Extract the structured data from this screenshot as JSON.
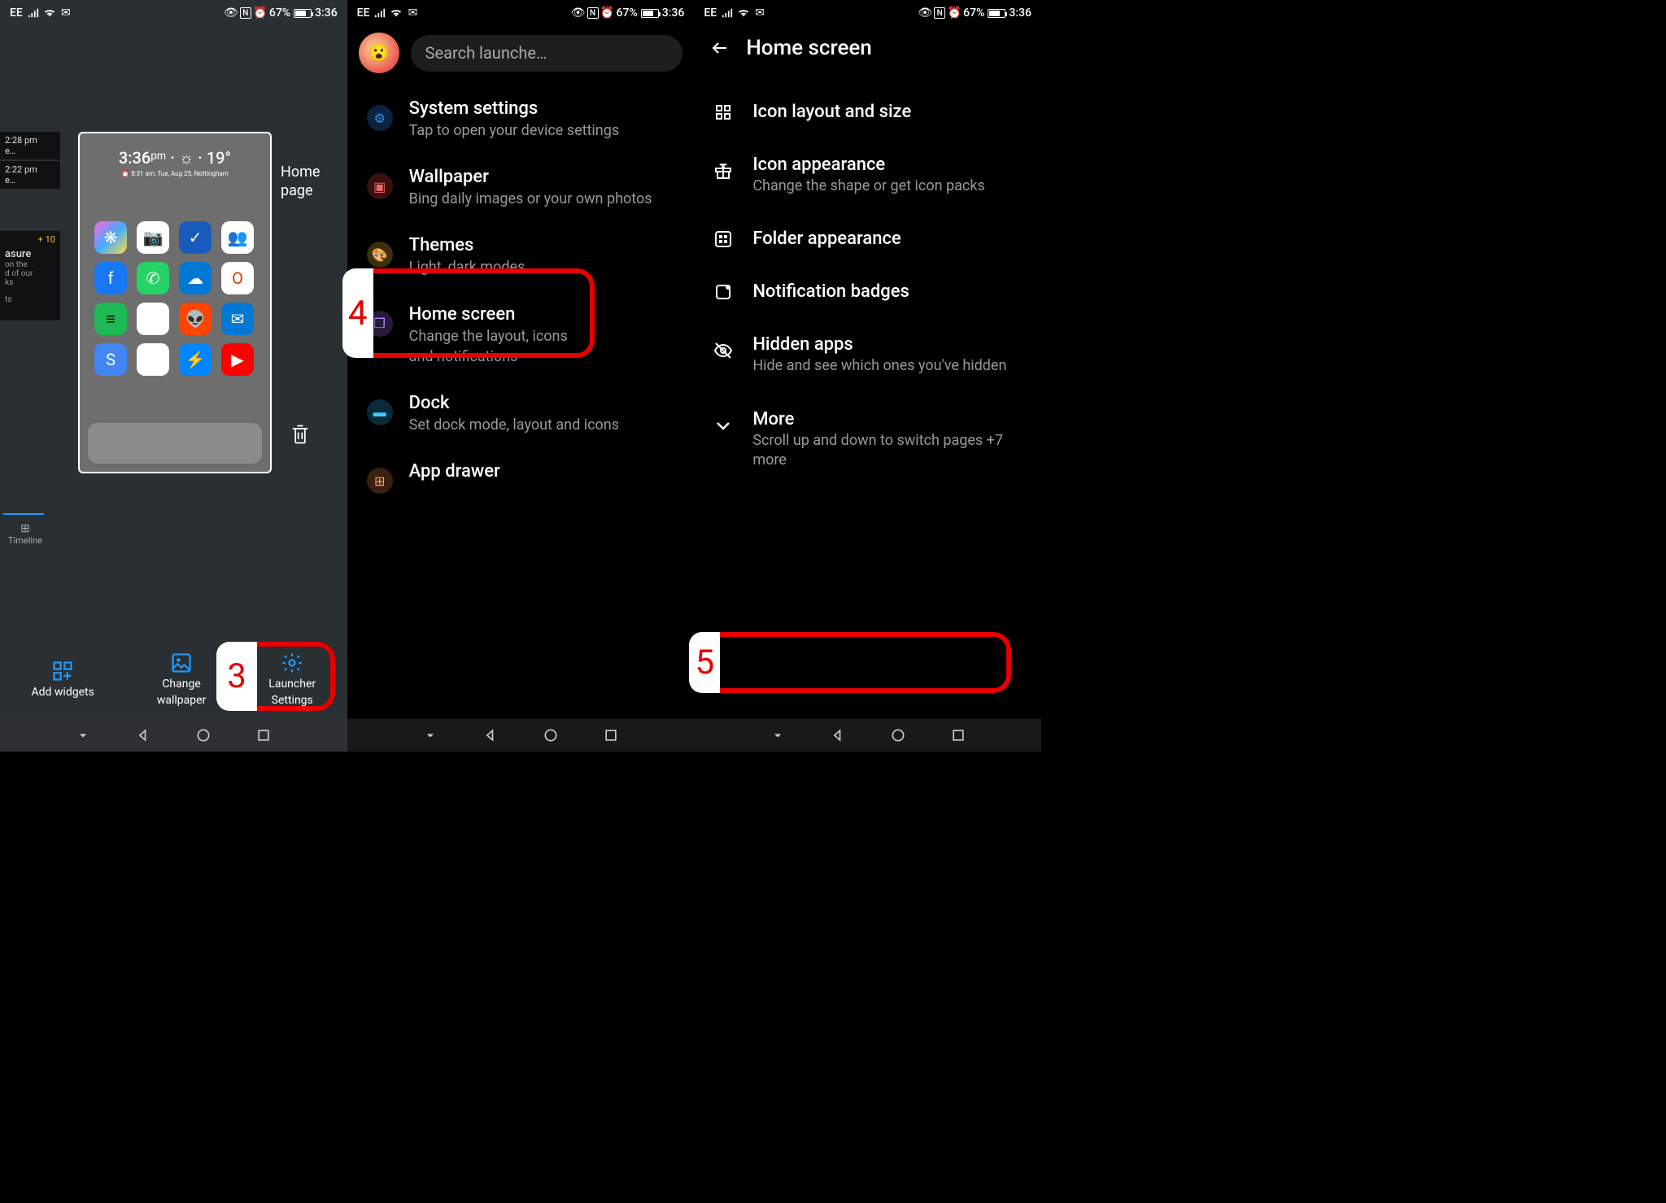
{
  "status": {
    "carrier": "EE",
    "battery": "67%",
    "time": "3:36",
    "nfc": "N"
  },
  "screen1": {
    "preview": {
      "time": "3:36ᵖᵐ · ☼ · 19°",
      "date": "⏰ 8:31 am, Tue, Aug 25, Nottingham"
    },
    "home_page_label_l1": "Home",
    "home_page_label_l2": "page",
    "timeline_label": "Timeline",
    "left_peek": {
      "t1": "2:28 pm",
      "t1b": "e…",
      "t2": "2:22 pm",
      "t2b": "e…",
      "plus": "+ 10",
      "title": "asure",
      "sub1": "on the",
      "sub2": "d of our",
      "sub3": "ks",
      "sub4": "ts"
    },
    "actions": {
      "widgets": "Add widgets",
      "wallpaper_l1": "Change",
      "wallpaper_l2": "wallpaper",
      "launcher_l1": "Launcher",
      "launcher_l2": "Settings"
    },
    "callout": "3"
  },
  "screen2": {
    "search_placeholder": "Search launche…",
    "items": [
      {
        "title": "System settings",
        "sub": "Tap to open your device settings",
        "icon": "gear"
      },
      {
        "title": "Wallpaper",
        "sub": "Bing daily images or your own photos",
        "icon": "image"
      },
      {
        "title": "Themes",
        "sub": "Light, dark modes",
        "icon": "palette"
      },
      {
        "title": "Home screen",
        "sub": "Change the layout, icons and notifications",
        "icon": "phone"
      },
      {
        "title": "Dock",
        "sub": "Set dock mode, layout and icons",
        "icon": "dock"
      },
      {
        "title": "App drawer",
        "sub": "",
        "icon": "drawer"
      }
    ],
    "callout": "4"
  },
  "screen3": {
    "title": "Home screen",
    "items": [
      {
        "title": "Icon layout and size",
        "sub": ""
      },
      {
        "title": "Icon appearance",
        "sub": "Change the shape or get icon packs"
      },
      {
        "title": "Folder appearance",
        "sub": ""
      },
      {
        "title": "Notification badges",
        "sub": ""
      },
      {
        "title": "Hidden apps",
        "sub": "Hide and see which ones you've hidden"
      },
      {
        "title": "More",
        "sub": "Scroll up and down to switch pages +7 more"
      }
    ],
    "callout": "5"
  }
}
